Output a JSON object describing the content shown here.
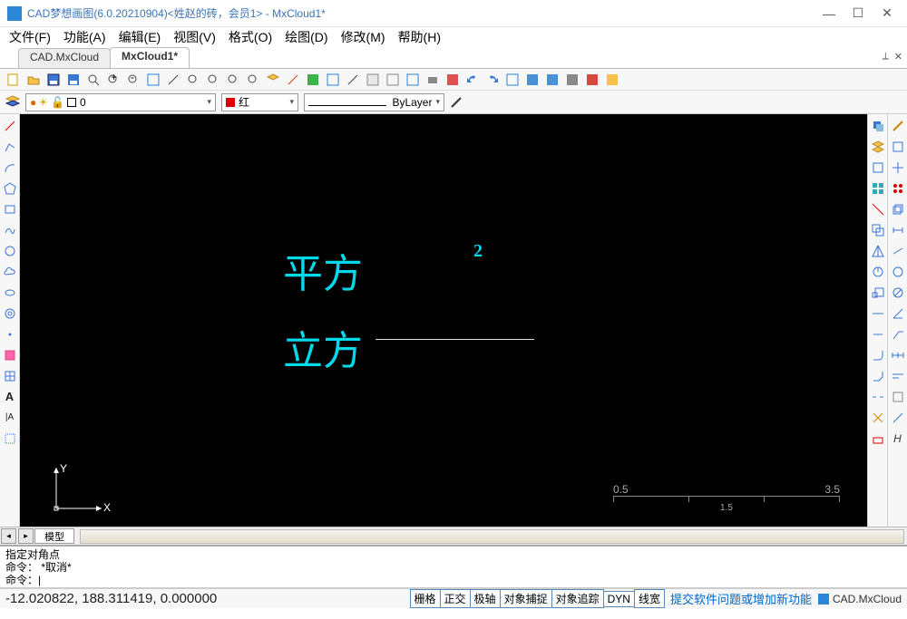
{
  "title": "CAD梦想画图(6.0.20210904)<姓赵的砖，会员1> - MxCloud1*",
  "menu": [
    "文件(F)",
    "功能(A)",
    "编辑(E)",
    "视图(V)",
    "格式(O)",
    "绘图(D)",
    "修改(M)",
    "帮助(H)"
  ],
  "tabs": {
    "t1": "CAD.MxCloud",
    "t2": "MxCloud1*"
  },
  "layer": {
    "label": "0"
  },
  "color": {
    "label": "红"
  },
  "linetype": {
    "label": "ByLayer"
  },
  "canvas": {
    "text1": "平方",
    "text2": "立方",
    "text3": "2",
    "ruler_top_left": "0.5",
    "ruler_top_right": "3.5",
    "ruler_bot": "1.5",
    "ucs_y": "Y",
    "ucs_x": "X"
  },
  "model_tab": "模型",
  "cmd": {
    "l1": "指定对角点",
    "l2": "命令： *取消*",
    "l3": "命令：|"
  },
  "status": {
    "coords": "-12.020822,  188.311419,  0.000000",
    "btns": [
      "栅格",
      "正交",
      "极轴",
      "对象捕捉",
      "对象追踪",
      "DYN",
      "线宽"
    ],
    "link": "提交软件问题或增加新功能",
    "brand": "CAD.MxCloud"
  }
}
